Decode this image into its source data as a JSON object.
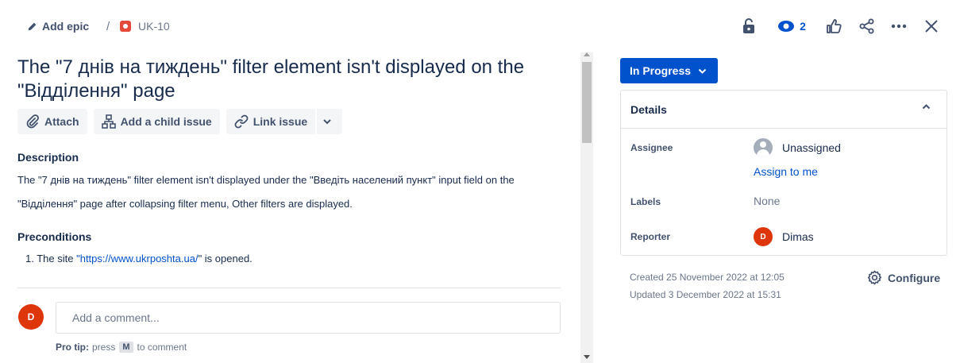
{
  "breadcrumb": {
    "epic_label": "Add epic",
    "separator": "/",
    "issue_key": "UK-10"
  },
  "toolbar": {
    "watch_count": "2"
  },
  "issue": {
    "title": "The \"7 днів на тиждень\" filter element isn't displayed on the \"Відділення\" page"
  },
  "actions": {
    "attach": "Attach",
    "add_child": "Add a child issue",
    "link_issue": "Link issue"
  },
  "description": {
    "heading": "Description",
    "text": "The \"7 днів на тиждень\" filter element isn't displayed under the \"Введіть населений пункт\" input field on the \"Відділення\" page after collapsing filter menu, Other filters are displayed."
  },
  "preconditions": {
    "heading": "Preconditions",
    "item_number": "1.",
    "item_prefix": "The site ",
    "item_link": "\"https://www.ukrposhta.ua/",
    "item_suffix": "\" is opened."
  },
  "comment": {
    "avatar_initial": "D",
    "placeholder": "Add a comment...",
    "protip_label": "Pro tip:",
    "protip_press": "press",
    "protip_key": "M",
    "protip_suffix": "to comment"
  },
  "status": {
    "label": "In Progress"
  },
  "details": {
    "heading": "Details",
    "assignee_label": "Assignee",
    "assignee_value": "Unassigned",
    "assign_to_me": "Assign to me",
    "labels_label": "Labels",
    "labels_value": "None",
    "reporter_label": "Reporter",
    "reporter_initial": "D",
    "reporter_name": "Dimas"
  },
  "meta": {
    "created": "Created 25 November 2022 at 12:05",
    "updated": "Updated 3 December 2022 at 15:31",
    "configure": "Configure"
  },
  "colors": {
    "primary": "#0052cc",
    "avatar": "#de350b",
    "bug": "#e5493a"
  }
}
